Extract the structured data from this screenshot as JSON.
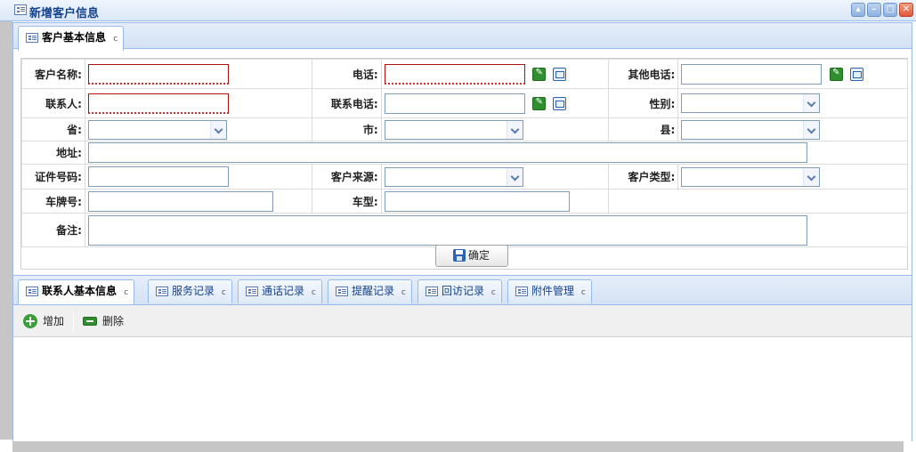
{
  "window": {
    "title": "新增客户信息",
    "tools": [
      "▴",
      "–",
      "▢",
      "✕"
    ]
  },
  "top_tab": {
    "label": "客户基本信息",
    "refresh": "c"
  },
  "form": {
    "customer_name_label": "客户名称:",
    "phone_label": "电话:",
    "other_phone_label": "其他电话:",
    "contact_label": "联系人:",
    "contact_phone_label": "联系电话:",
    "gender_label": "性别:",
    "province_label": "省:",
    "city_label": "市:",
    "county_label": "县:",
    "address_label": "地址:",
    "id_number_label": "证件号码:",
    "source_label": "客户来源:",
    "type_label": "客户类型:",
    "plate_label": "车牌号:",
    "model_label": "车型:",
    "remark_label": "备注:",
    "confirm_label": "确定"
  },
  "bottom_tabs": [
    {
      "label": "联系人基本信息",
      "refresh": "c"
    },
    {
      "label": "服务记录",
      "refresh": "c"
    },
    {
      "label": "通话记录",
      "refresh": "c"
    },
    {
      "label": "提醒记录",
      "refresh": "c"
    },
    {
      "label": "回访记录",
      "refresh": "c"
    },
    {
      "label": "附件管理",
      "refresh": "c"
    }
  ],
  "toolbar": {
    "add_label": "增加",
    "delete_label": "删除"
  }
}
